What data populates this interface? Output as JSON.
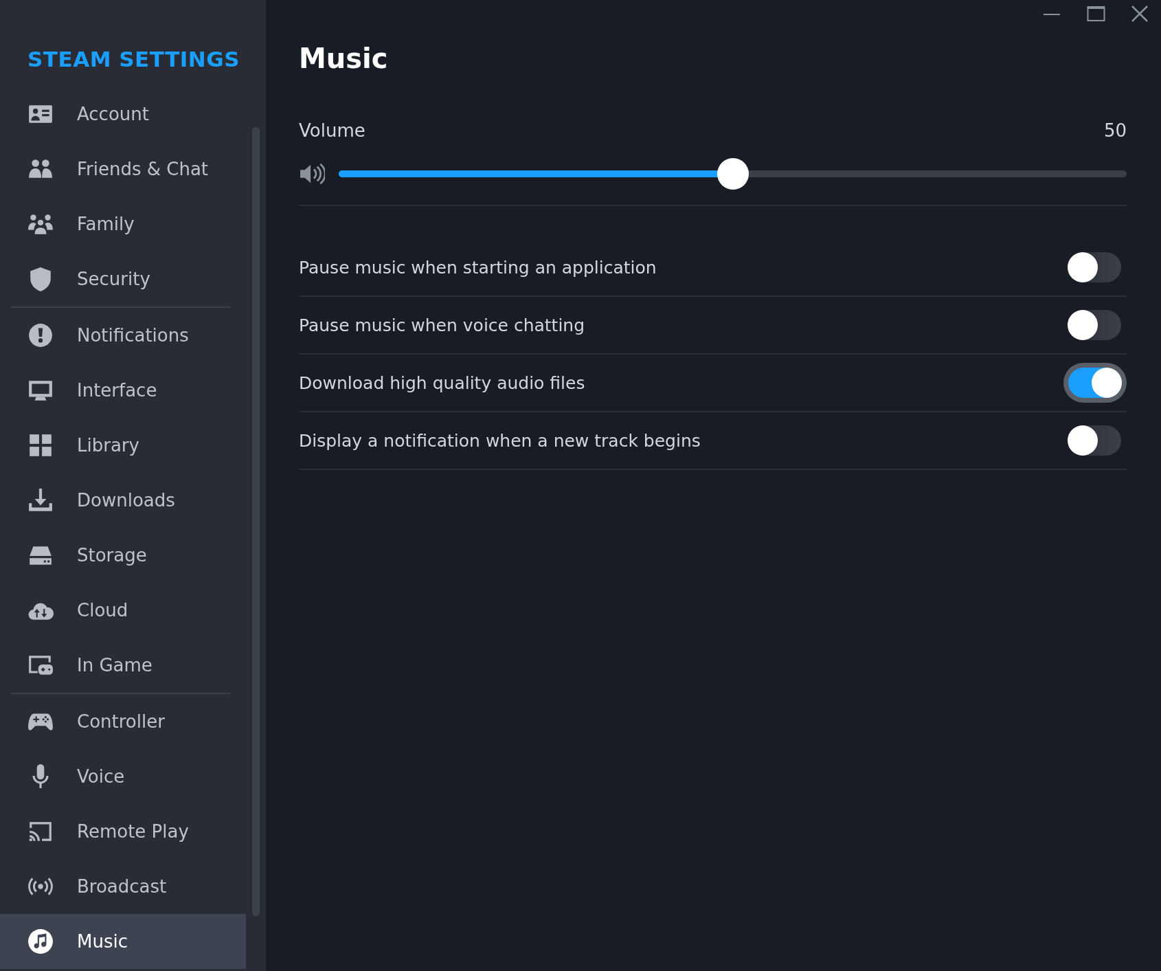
{
  "sidebar": {
    "heading": "STEAM SETTINGS",
    "sections": [
      {
        "items": [
          {
            "label": "Account",
            "selected": false
          },
          {
            "label": "Friends & Chat",
            "selected": false
          },
          {
            "label": "Family",
            "selected": false
          },
          {
            "label": "Security",
            "selected": false
          }
        ]
      },
      {
        "items": [
          {
            "label": "Notifications",
            "selected": false
          },
          {
            "label": "Interface",
            "selected": false
          },
          {
            "label": "Library",
            "selected": false
          },
          {
            "label": "Downloads",
            "selected": false
          },
          {
            "label": "Storage",
            "selected": false
          },
          {
            "label": "Cloud",
            "selected": false
          },
          {
            "label": "In Game",
            "selected": false
          }
        ]
      },
      {
        "items": [
          {
            "label": "Controller",
            "selected": false
          },
          {
            "label": "Voice",
            "selected": false
          },
          {
            "label": "Remote Play",
            "selected": false
          },
          {
            "label": "Broadcast",
            "selected": false
          },
          {
            "label": "Music",
            "selected": true
          }
        ]
      }
    ]
  },
  "page": {
    "title": "Music",
    "volume": {
      "label": "Volume",
      "reading": "50",
      "level": 0.5
    },
    "toggles": [
      {
        "label": "Pause music when starting an application",
        "on": false
      },
      {
        "label": "Pause music when voice chatting",
        "on": false
      },
      {
        "label": "Download high quality audio files",
        "on": true
      },
      {
        "label": "Display a notification when a new track begins",
        "on": false
      }
    ]
  }
}
